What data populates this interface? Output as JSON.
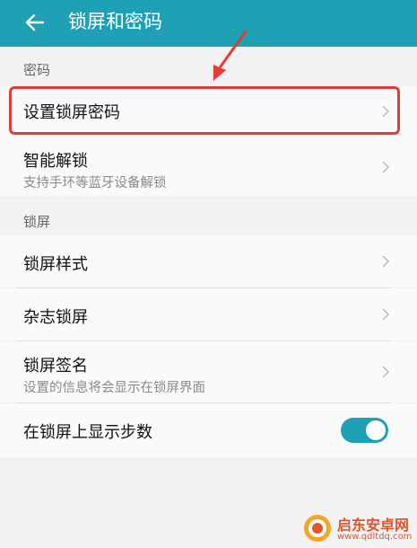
{
  "header": {
    "title": "锁屏和密码",
    "back_icon": "arrow-left-icon"
  },
  "accent_color": "#1ea0b5",
  "highlight_color": "#e53a35",
  "sections": [
    {
      "title": "密码",
      "items": [
        {
          "label": "设置锁屏密码",
          "sub": ""
        },
        {
          "label": "智能解锁",
          "sub": "支持手环等蓝牙设备解锁"
        }
      ]
    },
    {
      "title": "锁屏",
      "items": [
        {
          "label": "锁屏样式",
          "sub": ""
        },
        {
          "label": "杂志锁屏",
          "sub": ""
        },
        {
          "label": "锁屏签名",
          "sub": "设置的信息将会显示在锁屏界面"
        },
        {
          "label": "在锁屏上显示步数",
          "sub": "",
          "toggle": true
        }
      ]
    }
  ],
  "watermark": {
    "title": "启东安卓网",
    "url": "www.qdltdq.com"
  }
}
